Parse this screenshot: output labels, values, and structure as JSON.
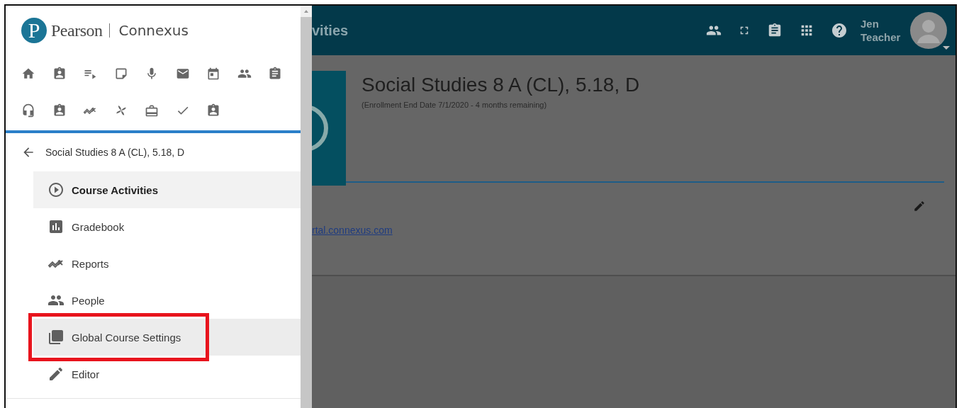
{
  "drawer": {
    "logo": {
      "mark": "P",
      "brand": "Pearson",
      "product": "Connexus"
    },
    "course_title": "Social Studies 8 A (CL), 5.18, D",
    "menu_items": [
      {
        "label": "Course Activities",
        "selected": true,
        "hovered": false,
        "annotated": false
      },
      {
        "label": "Gradebook",
        "selected": false,
        "hovered": false,
        "annotated": false
      },
      {
        "label": "Reports",
        "selected": false,
        "hovered": false,
        "annotated": false
      },
      {
        "label": "People",
        "selected": false,
        "hovered": false,
        "annotated": false
      },
      {
        "label": "Global Course Settings",
        "selected": false,
        "hovered": true,
        "annotated": true
      },
      {
        "label": "Editor",
        "selected": false,
        "hovered": false,
        "annotated": false
      }
    ]
  },
  "header": {
    "title": "vities",
    "user_name": "Jen Teacher"
  },
  "course": {
    "title": "Social Studies 8 A (CL), 5.18, D",
    "enrollment": "(Enrollment End Date 7/1/2020 - 4 months remaining)",
    "link": "rtal.connexus.com"
  }
}
